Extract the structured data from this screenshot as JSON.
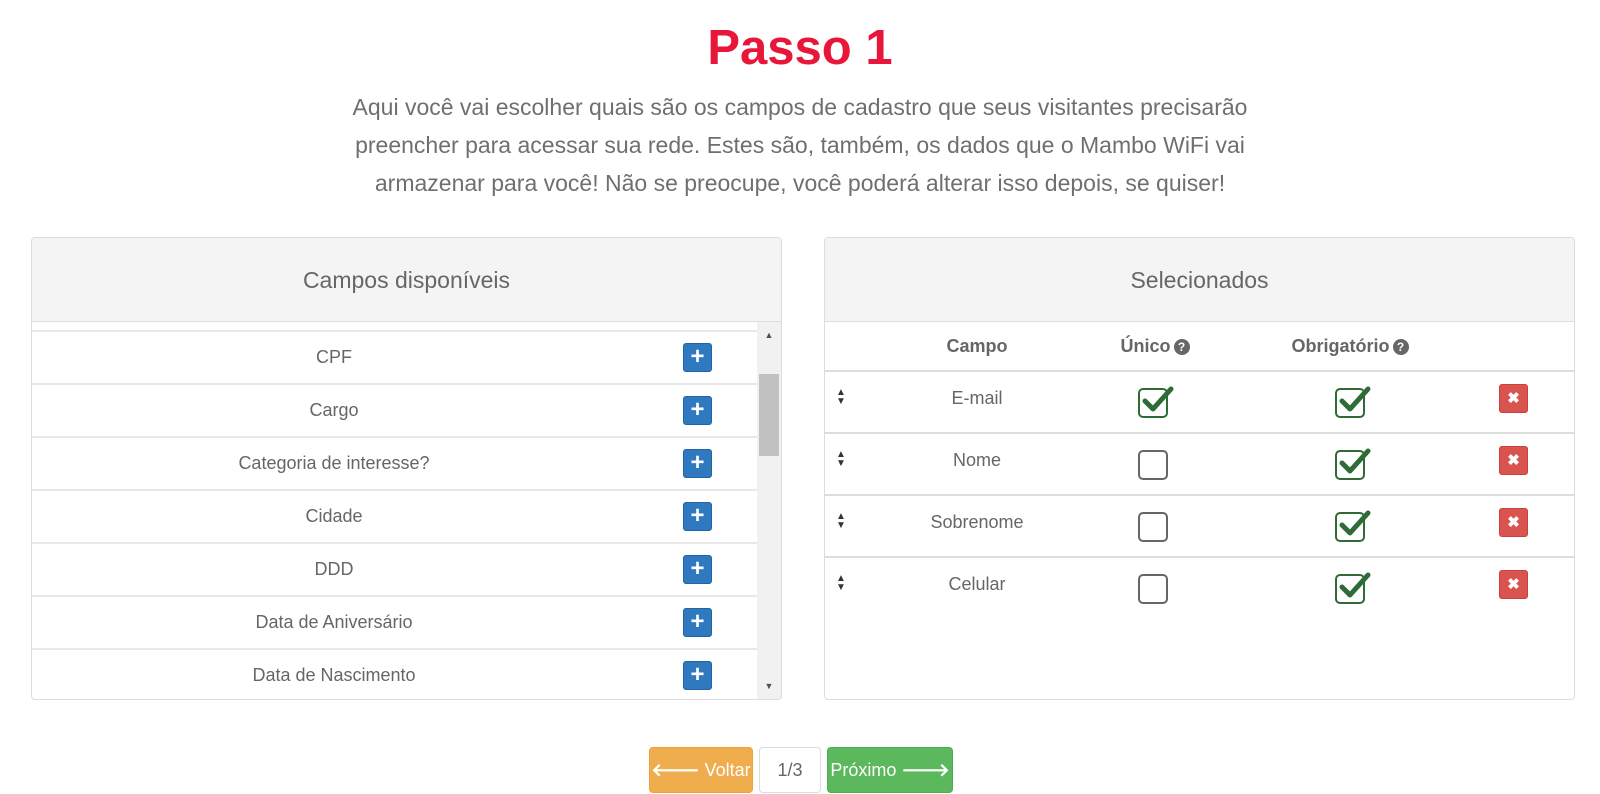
{
  "page": {
    "title": "Passo 1",
    "intro": "Aqui você vai escolher quais são os campos de cadastro que seus visitantes precisarão preencher para acessar sua rede. Estes são, também, os dados que o Mambo WiFi vai armazenar para você! Não se preocupe, você poderá alterar isso depois, se quiser!"
  },
  "available": {
    "header": "Campos disponíveis",
    "add_icon": "plus-icon",
    "items": [
      "CPF",
      "Cargo",
      "Categoria de interesse?",
      "Cidade",
      "DDD",
      "Data de Aniversário",
      "Data de Nascimento"
    ]
  },
  "selected": {
    "header": "Selecionados",
    "columns": {
      "campo": "Campo",
      "unico": "Único",
      "obrigatorio": "Obrigatório"
    },
    "help_icon": "question-circle-icon",
    "rows": [
      {
        "campo": "E-mail",
        "unico": true,
        "obrigatorio": true
      },
      {
        "campo": "Nome",
        "unico": false,
        "obrigatorio": true
      },
      {
        "campo": "Sobrenome",
        "unico": false,
        "obrigatorio": true
      },
      {
        "campo": "Celular",
        "unico": false,
        "obrigatorio": true
      }
    ]
  },
  "pager": {
    "back_label": "Voltar",
    "page": "1/3",
    "next_label": "Próximo"
  },
  "colors": {
    "title": "#e8173a",
    "add_button": "#2e79c0",
    "delete_button": "#d9534f",
    "check": "#2f6b36",
    "back_button": "#f0ad4e",
    "next_button": "#5cb85c"
  }
}
